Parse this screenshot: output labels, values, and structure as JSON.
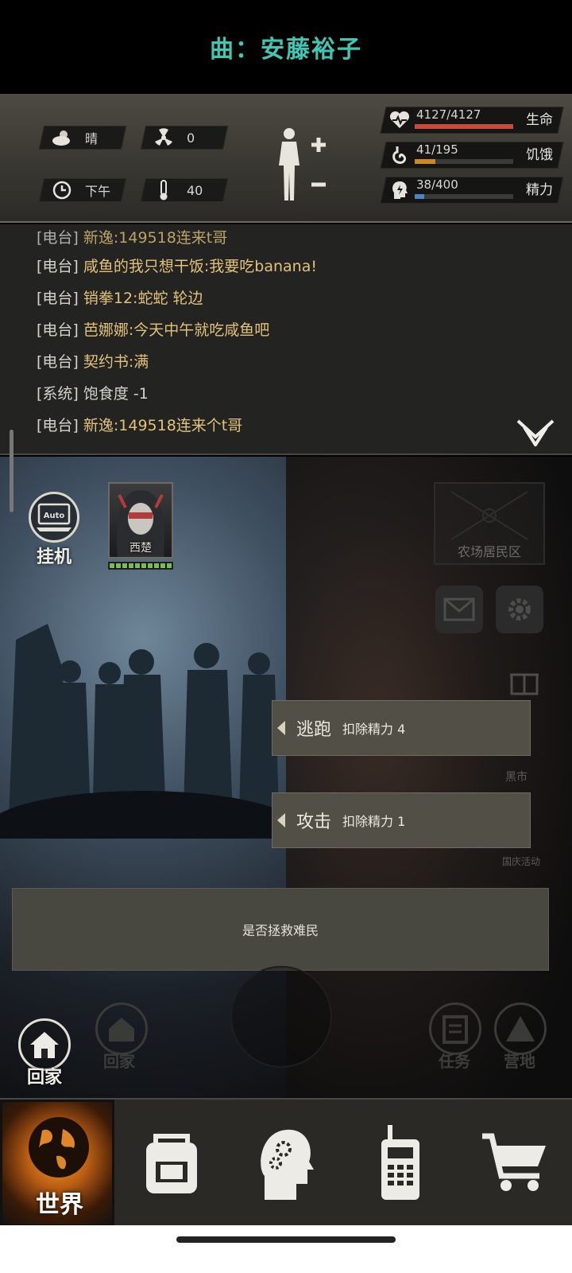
{
  "header": {
    "song_title": "曲：安藤裕子"
  },
  "status": {
    "weather": "晴",
    "radiation": "0",
    "time_of_day": "下午",
    "temperature": "40",
    "stats": [
      {
        "name": "生命",
        "value": "4127/4127",
        "fill": 1.0,
        "color": "#c94b3c",
        "icon": "heart-pulse-icon"
      },
      {
        "name": "饥饿",
        "value": "41/195",
        "fill": 0.21,
        "color": "#c98a2c",
        "icon": "stomach-icon"
      },
      {
        "name": "精力",
        "value": "38/400",
        "fill": 0.095,
        "color": "#4b84c4",
        "icon": "energy-head-icon"
      }
    ]
  },
  "chat": {
    "lines": [
      {
        "tag": "[电台]",
        "msg": "新逸:149518连来t哥",
        "sys": false
      },
      {
        "tag": "[电台]",
        "msg": "咸鱼的我只想干饭:我要吃banana!",
        "sys": false
      },
      {
        "tag": "[电台]",
        "msg": "销拳12:蛇蛇 轮边",
        "sys": false
      },
      {
        "tag": "[电台]",
        "msg": "芭娜娜:今天中午就吃咸鱼吧",
        "sys": false
      },
      {
        "tag": "[电台]",
        "msg": "契约书:满",
        "sys": false
      },
      {
        "tag": "[系统]",
        "msg": "饱食度 -1",
        "sys": true
      },
      {
        "tag": "[电台]",
        "msg": "新逸:149518连来个t哥",
        "sys": false
      }
    ]
  },
  "scene": {
    "auto_icon_text": "Auto",
    "auto_label": "挂机",
    "npc_name": "西楚",
    "location_label": "农场居民区",
    "side_labels": {
      "black_market": "黑市",
      "event": "国庆活动"
    },
    "choices": [
      {
        "verb": "逃跑",
        "cost": "扣除精力 4"
      },
      {
        "verb": "攻击",
        "cost": "扣除精力 1"
      }
    ],
    "prompt": "是否拯救难民",
    "home_label": "回家",
    "home_label_dim": "回家",
    "task_label": "任务",
    "camp_label": "营地"
  },
  "nav": {
    "world_label": "世界"
  }
}
